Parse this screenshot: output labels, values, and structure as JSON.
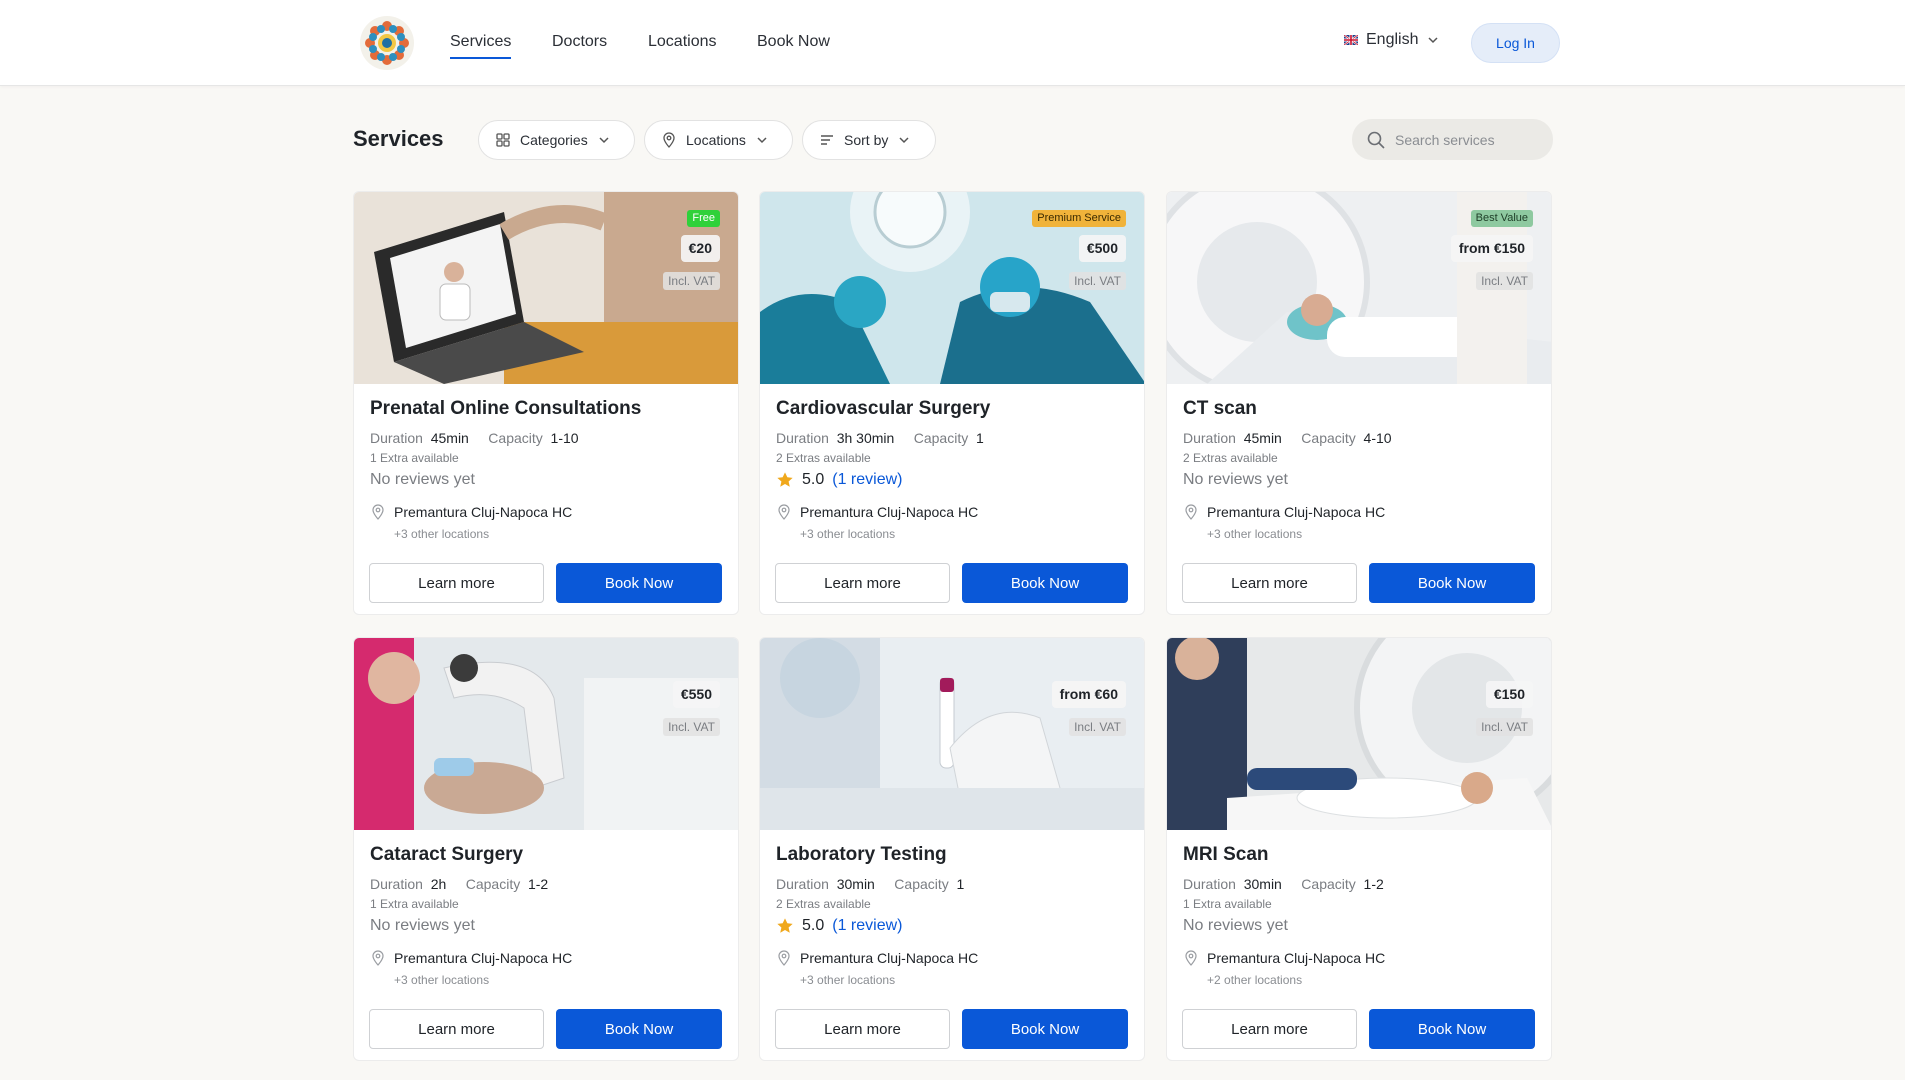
{
  "nav": {
    "items": [
      "Services",
      "Doctors",
      "Locations",
      "Book Now"
    ],
    "language": "English",
    "login_label": "Log In",
    "accent_color": "#0a58d8"
  },
  "toolbar": {
    "title": "Services",
    "filters": {
      "categories": "Categories",
      "locations": "Locations",
      "sort": "Sort by"
    },
    "search_placeholder": "Search services"
  },
  "labels": {
    "duration": "Duration",
    "capacity": "Capacity",
    "learn_more": "Learn more",
    "book_now": "Book Now"
  },
  "cards": [
    {
      "title": "Prenatal Online Consultations",
      "tag": "Free",
      "tag_color": "#2fd13a",
      "price": "€20",
      "vat": "Incl. VAT",
      "duration": "45min",
      "capacity": "1-10",
      "extras": "1 Extra available",
      "reviews_text": "No reviews yet",
      "location": "Premantura Cluj-Napoca HC",
      "other_locations": "+3 other locations"
    },
    {
      "title": "Cardiovascular Surgery",
      "tag": "Premium Service",
      "tag_color": "#f0b33a",
      "price": "€500",
      "vat": "Incl. VAT",
      "duration": "3h 30min",
      "capacity": "1",
      "extras": "2 Extras available",
      "rating": "5.0",
      "review_count": "(1 review)",
      "location": "Premantura Cluj-Napoca HC",
      "other_locations": "+3 other locations"
    },
    {
      "title": "CT scan",
      "tag": "Best Value",
      "tag_color": "#8ec9a0",
      "price": "from €150",
      "vat": "Incl. VAT",
      "duration": "45min",
      "capacity": "4-10",
      "extras": "2 Extras available",
      "reviews_text": "No reviews yet",
      "location": "Premantura Cluj-Napoca HC",
      "other_locations": "+3 other locations"
    },
    {
      "title": "Cataract Surgery",
      "price": "€550",
      "vat": "Incl. VAT",
      "duration": "2h",
      "capacity": "1-2",
      "extras": "1 Extra available",
      "reviews_text": "No reviews yet",
      "location": "Premantura Cluj-Napoca HC",
      "other_locations": "+3 other locations"
    },
    {
      "title": "Laboratory Testing",
      "price": "from €60",
      "vat": "Incl. VAT",
      "duration": "30min",
      "capacity": "1",
      "extras": "2 Extras available",
      "rating": "5.0",
      "review_count": "(1 review)",
      "location": "Premantura Cluj-Napoca HC",
      "other_locations": "+3 other locations"
    },
    {
      "title": "MRI Scan",
      "price": "€150",
      "vat": "Incl. VAT",
      "duration": "30min",
      "capacity": "1-2",
      "extras": "1 Extra available",
      "reviews_text": "No reviews yet",
      "location": "Premantura Cluj-Napoca HC",
      "other_locations": "+2 other locations"
    }
  ]
}
